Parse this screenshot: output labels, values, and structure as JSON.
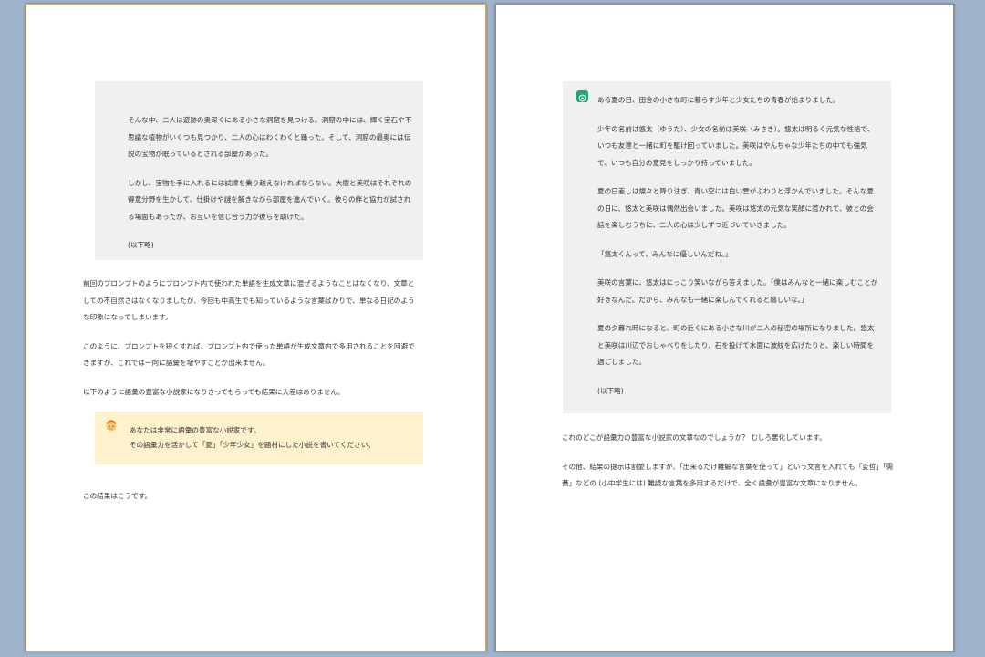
{
  "left_page": {
    "quote_paragraphs": [
      "そんな中、二人は遊跡の奥深くにある小さな洞窟を見つける。洞窟の中には、輝く宝石や不思議な植物がいくつも見つかり、二人の心はわくわくと踊った。そして、洞窟の最奥には伝説の宝物が眠っているとされる部屋があった。",
      "しかし、宝物を手に入れるには試練を乗り越えなければならない。大樹と美咲はそれぞれの得意分野を生かして、仕掛けや謎を解きながら部屋を進んでいく。彼らの絆と協力が試される場面もあったが、お互いを信じ合う力が彼らを助けた。",
      "(以下略)"
    ],
    "body_paragraphs": [
      "前回のプロンプトのようにプロンプト内で使われた単語を生成文章に混ぜるようなことはなくなり、文章としての不自然さはなくなりましたが、今回も中高生でも知っているような言葉ばかりで、単なる日記のような印象になってしまいます。",
      "このように、プロンプトを短くすれば、プロンプト内で使った単語が生成文章内で多用されることを回避できますが、これでは一向に語彙を増やすことが出来ません。",
      "以下のように語彙の豊富な小説家になりきってもらっても結果に大差はありません。"
    ],
    "prompt_lines": [
      "あなたは非常に語彙の豊富な小説家です。",
      "その語彙力を活かして「夏」「少年少女」を題材にした小説を書いてください。"
    ],
    "closing": "この結果はこうです。"
  },
  "right_page": {
    "response_paragraphs": [
      "ある夏の日、田舎の小さな町に暮らす少年と少女たちの青春が始まりました。",
      "少年の名前は悠太（ゆうた）、少女の名前は美咲（みさき）。悠太は明るく元気な性格で、いつも友達と一緒に町を駆け回っていました。美咲はやんちゃな少年たちの中でも強気で、いつも自分の意見をしっかり持っていました。",
      "夏の日差しは燦々と降り注ぎ、青い空には白い雲がふわりと浮かんでいました。そんな夏の日に、悠太と美咲は偶然出会いました。美咲は悠太の元気な笑顔に惹かれて、彼との会話を楽しむうちに、二人の心は少しずつ近づいていきました。",
      "「悠太くんって、みんなに優しいんだね。」",
      "美咲の言葉に、悠太はにっこり笑いながら答えました。「僕はみんなと一緒に楽しむことが好きなんだ。だから、みんなも一緒に楽しんでくれると嬉しいな。」",
      "夏の夕暮れ時になると、町の近くにある小さな川が二人の秘密の場所になりました。悠太と美咲は川辺でおしゃべりをしたり、石を投げて水面に波紋を広げたりと、楽しい時間を過ごしました。",
      "(以下略)"
    ],
    "body_paragraphs": [
      "これのどこが語彙力の豊富な小説家の文章なのでしょうか？ むしろ悪化しています。",
      "その他、結果の提示は割愛しますが、「出来るだけ難解な言葉を使って」という文言を入れても「変哲」「需蕎」などの (小中学生には) 難読な言葉を多用するだけで、全く語彙が豊富な文章になりません。"
    ]
  },
  "colors": {
    "background": "#9fb3cc",
    "quote_box": "#f0f0f0",
    "prompt_box": "#fdf2cc",
    "gpt_icon": "#1fa37f"
  },
  "icons": {
    "user_avatar": "user-avatar-icon",
    "assistant_avatar": "chatgpt-icon"
  }
}
